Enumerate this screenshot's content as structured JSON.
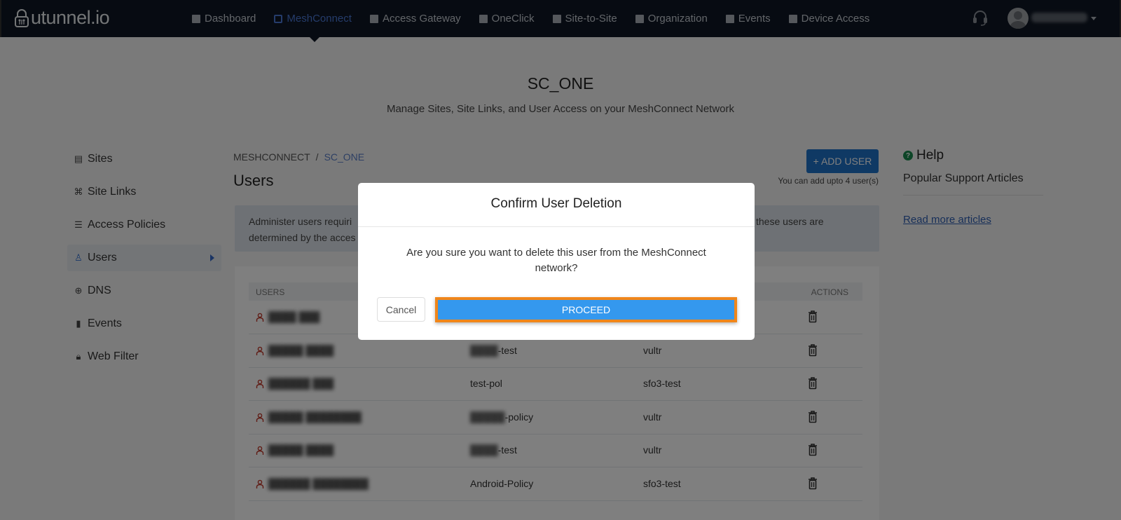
{
  "navbar": {
    "brand": "utunnel.io",
    "items": [
      {
        "label": "Dashboard",
        "icon": "home-icon",
        "active": false
      },
      {
        "label": "MeshConnect",
        "icon": "mesh-icon",
        "active": true
      },
      {
        "label": "Access Gateway",
        "icon": "gateway-icon",
        "active": false
      },
      {
        "label": "OneClick",
        "icon": "grid-icon",
        "active": false
      },
      {
        "label": "Site-to-Site",
        "icon": "link-icon",
        "active": false
      },
      {
        "label": "Organization",
        "icon": "building-icon",
        "active": false
      },
      {
        "label": "Events",
        "icon": "list-icon",
        "active": false
      },
      {
        "label": "Device Access",
        "icon": "monitor-icon",
        "active": false
      }
    ],
    "support_icon": "headset-icon",
    "user_name": "redacted"
  },
  "page": {
    "title": "SC_ONE",
    "subtitle": "Manage Sites, Site Links, and User Access on your MeshConnect Network"
  },
  "sidebar": {
    "items": [
      {
        "label": "Sites",
        "icon": "sites-icon",
        "active": false
      },
      {
        "label": "Site Links",
        "icon": "command-icon",
        "active": false
      },
      {
        "label": "Access Policies",
        "icon": "policies-icon",
        "active": false
      },
      {
        "label": "Users",
        "icon": "user-icon",
        "active": true
      },
      {
        "label": "DNS",
        "icon": "globe-icon",
        "active": false
      },
      {
        "label": "Events",
        "icon": "events-icon",
        "active": false
      },
      {
        "label": "Web Filter",
        "icon": "lock-icon",
        "active": false
      }
    ]
  },
  "main": {
    "breadcrumb": [
      "MESHCONNECT",
      "SC_ONE"
    ],
    "breadcrumb_sep": "/",
    "section_title": "Users",
    "add_user_label": "+ ADD USER",
    "limit_note": "You can add upto 4 user(s)",
    "info_line1_start": "Administer users requiri",
    "info_line1_end": "these users are",
    "info_line2_start": "determined by the acces",
    "table": {
      "headers": [
        "USERS",
        "ACTIONS"
      ],
      "rows": [
        {
          "user": "████ ███",
          "policy_blur": "",
          "policy": "",
          "site": ""
        },
        {
          "user": "█████ ████",
          "policy_blur": "████",
          "policy": "-test",
          "site": "vultr"
        },
        {
          "user": "██████ ███",
          "policy_blur": "",
          "policy": "test-pol",
          "site": "sfo3-test"
        },
        {
          "user": "█████ ████████",
          "policy_blur": "█████",
          "policy": "-policy",
          "site": "vultr"
        },
        {
          "user": "█████ ████",
          "policy_blur": "████",
          "policy": "-test",
          "site": "vultr"
        },
        {
          "user": "██████ ████████",
          "policy_blur": "",
          "policy": "Android-Policy",
          "site": "sfo3-test"
        }
      ]
    }
  },
  "help": {
    "title": "Help",
    "subtitle": "Popular Support Articles",
    "link": "Read more articles"
  },
  "modal": {
    "title": "Confirm User Deletion",
    "message": "Are you sure you want to delete this user from the MeshConnect network?",
    "cancel_label": "Cancel",
    "proceed_label": "PROCEED"
  },
  "colors": {
    "navbar_bg": "#0f1724",
    "accent": "#3498ee",
    "highlight": "#f0861a",
    "brand_blue": "#1f72c8"
  }
}
